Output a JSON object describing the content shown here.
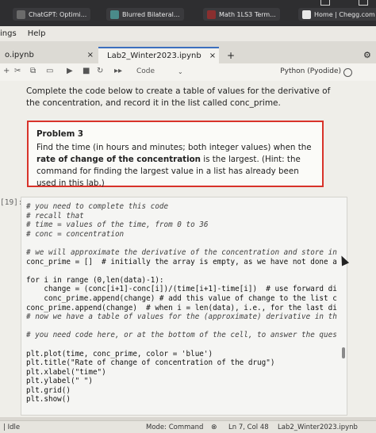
{
  "bookmarks": [
    {
      "label": "ChatGPT: Optimi...",
      "color": "#6b6b6b"
    },
    {
      "label": "Blurred Bilateral...",
      "color": "#4a8b8a"
    },
    {
      "label": "Math 1LS3 Term...",
      "color": "#8a2f2f"
    },
    {
      "label": "Home | Chegg.com",
      "color": "#e8e8e8"
    }
  ],
  "menubar": {
    "items": [
      "ings",
      "Help"
    ]
  },
  "tabs": [
    {
      "label": "o.ipynb",
      "close": "×"
    },
    {
      "label": "Lab2_Winter2023.ipynb",
      "close": "×"
    }
  ],
  "new_tab": "+",
  "toolbar": {
    "cell_type": "Code",
    "kernel": "Python (Pyodide)"
  },
  "notebook": {
    "intro": "Complete the code below to create a table of values for the derivative of the concentration, and record it in the list called conc_prime.",
    "problem_title": "Problem 3",
    "problem_text_a": "Find the time (in hours and minutes; both integer values) when the ",
    "problem_bold": "rate of change of the concentration",
    "problem_text_b": " is the largest. (Hint: the command for finding the largest value in a list has already been used in this lab.)",
    "cell_prompt": "[19]:",
    "code_lines": [
      {
        "cls": "cm",
        "text": "# you need to complete this code"
      },
      {
        "cls": "cm",
        "text": "# recall that"
      },
      {
        "cls": "cm",
        "text": "# time = values of the time, from 0 to 36"
      },
      {
        "cls": "cm",
        "text": "# conc = concentration"
      },
      {
        "cls": "",
        "text": ""
      },
      {
        "cls": "cm",
        "text": "# we will approximate the derivative of the concentration and store in"
      },
      {
        "cls": "",
        "text": "conc_prime = []  # initially the array is empty, as we have not done a"
      },
      {
        "cls": "",
        "text": ""
      },
      {
        "cls": "",
        "text": "for i in range (0,len(data)-1):"
      },
      {
        "cls": "",
        "text": "    change = (conc[i+1]-conc[i])/(time[i+1]-time[i])  # use forward di"
      },
      {
        "cls": "",
        "text": "    conc_prime.append(change) # add this value of change to the list c"
      },
      {
        "cls": "",
        "text": "conc_prime.append(change)  # when i = len(data), i.e., for the last di"
      },
      {
        "cls": "cm",
        "text": "# now we have a table of values for the (approximate) derivative in th"
      },
      {
        "cls": "",
        "text": ""
      },
      {
        "cls": "cm",
        "text": "# you need code here, or at the bottom of the cell, to answer the ques"
      },
      {
        "cls": "",
        "text": ""
      },
      {
        "cls": "",
        "text": "plt.plot(time, conc_prime, color = 'blue')"
      },
      {
        "cls": "",
        "text": "plt.title(\"Rate of change of concentration of the drug\")"
      },
      {
        "cls": "",
        "text": "plt.xlabel(\"time\")"
      },
      {
        "cls": "",
        "text": "plt.ylabel(\" \")"
      },
      {
        "cls": "",
        "text": "plt.grid()"
      },
      {
        "cls": "",
        "text": "plt.show()"
      }
    ]
  },
  "statusbar": {
    "idle": "| Idle",
    "mode": "Mode: Command",
    "position": "Ln 7, Col 48",
    "file": "Lab2_Winter2023.ipynb"
  }
}
